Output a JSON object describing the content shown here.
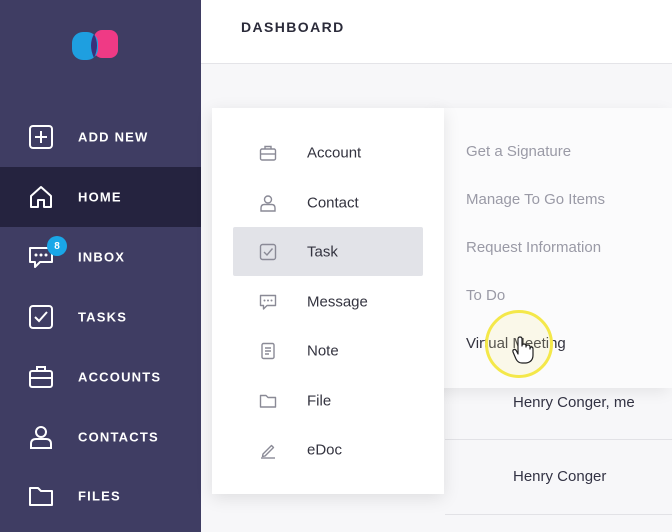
{
  "sidebar": {
    "logo_icon": "app-logo",
    "items": [
      {
        "label": "ADD NEW",
        "icon": "plus-square-icon"
      },
      {
        "label": "HOME",
        "icon": "home-icon",
        "active": true
      },
      {
        "label": "INBOX",
        "icon": "chat-icon",
        "badge": "8"
      },
      {
        "label": "TASKS",
        "icon": "checkbox-icon"
      },
      {
        "label": "ACCOUNTS",
        "icon": "briefcase-icon"
      },
      {
        "label": "CONTACTS",
        "icon": "person-icon"
      },
      {
        "label": "FILES",
        "icon": "folder-icon"
      }
    ]
  },
  "header": {
    "title": "DASHBOARD"
  },
  "menu": {
    "items": [
      {
        "label": "Account",
        "icon": "briefcase-icon"
      },
      {
        "label": "Contact",
        "icon": "person-icon"
      },
      {
        "label": "Task",
        "icon": "checkbox-icon",
        "selected": true
      },
      {
        "label": "Message",
        "icon": "chat-icon"
      },
      {
        "label": "Note",
        "icon": "note-icon"
      },
      {
        "label": "File",
        "icon": "folder-icon"
      },
      {
        "label": "eDoc",
        "icon": "pen-icon"
      }
    ]
  },
  "submenu": {
    "items": [
      {
        "label": "Get a Signature"
      },
      {
        "label": "Manage To Go Items"
      },
      {
        "label": "Request Information"
      },
      {
        "label": "To Do"
      },
      {
        "label": "Virtual Meeting"
      }
    ]
  },
  "rows": [
    {
      "text": "Henry Conger, me"
    },
    {
      "text": "Henry Conger"
    }
  ],
  "colors": {
    "sidebar": "#3f3d63",
    "sidebar_active": "#25233f",
    "badge": "#1aa7e8",
    "logo_blue": "#1e9fe0",
    "logo_pink": "#ef3a85",
    "cursor_highlight": "#f4e84a"
  }
}
